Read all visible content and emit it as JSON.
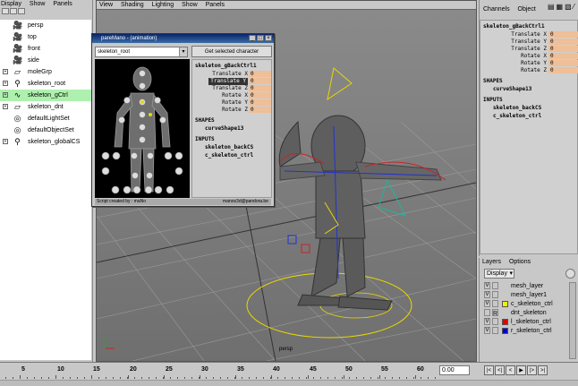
{
  "outliner": {
    "menu": [
      "Display",
      "Show",
      "Panels"
    ],
    "items": [
      {
        "label": "persp",
        "icon": "camera-icon",
        "expand": ""
      },
      {
        "label": "top",
        "icon": "camera-icon",
        "expand": ""
      },
      {
        "label": "front",
        "icon": "camera-icon",
        "expand": ""
      },
      {
        "label": "side",
        "icon": "camera-icon",
        "expand": ""
      },
      {
        "label": "moleGrp",
        "icon": "group-icon",
        "expand": "+"
      },
      {
        "label": "skeleton_root",
        "icon": "joint-icon",
        "expand": "+"
      },
      {
        "label": "skeleton_gCtrl",
        "icon": "curve-icon",
        "expand": "+"
      },
      {
        "label": "skeleton_dnt",
        "icon": "group-icon",
        "expand": "+"
      },
      {
        "label": "defaultLightSet",
        "icon": "set-icon",
        "expand": ""
      },
      {
        "label": "defaultObjectSet",
        "icon": "set-icon",
        "expand": ""
      },
      {
        "label": "skeleton_globalCS",
        "icon": "joint-icon",
        "expand": "+"
      }
    ],
    "selected_index": 6
  },
  "viewport": {
    "menu": [
      "View",
      "Shading",
      "Lighting",
      "Show",
      "Panels"
    ],
    "camera_label": "persp"
  },
  "channel_box": {
    "menu": [
      "Channels",
      "Object"
    ],
    "object": "skeleton_gBackCtrl1",
    "channels": [
      {
        "label": "Translate X",
        "value": "0"
      },
      {
        "label": "Translate Y",
        "value": "0"
      },
      {
        "label": "Translate Z",
        "value": "0"
      },
      {
        "label": "Rotate X",
        "value": "0"
      },
      {
        "label": "Rotate Y",
        "value": "0"
      },
      {
        "label": "Rotate Z",
        "value": "0"
      }
    ],
    "shapes_header": "SHAPES",
    "shape": "curveShape13",
    "inputs_header": "INPUTS",
    "inputs": [
      "skeleton_backCS",
      "c_skeleton_ctrl"
    ]
  },
  "layers": {
    "menu": [
      "Layers",
      "Options"
    ],
    "display_mode": "Display",
    "items": [
      {
        "v": "V",
        "name": "mesh_layer",
        "color": "",
        "flag": ""
      },
      {
        "v": "V",
        "name": "mesh_layer1",
        "color": "",
        "flag": ""
      },
      {
        "v": "V",
        "name": "c_skeleton_ctrl",
        "color": "#f0f000",
        "flag": ""
      },
      {
        "v": "",
        "name": "dnt_skeleton",
        "color": "",
        "flag": "R"
      },
      {
        "v": "V",
        "name": "l_skeleton_ctrl",
        "color": "#e00000",
        "flag": ""
      },
      {
        "v": "V",
        "name": "r_skeleton_ctrl",
        "color": "#0000d0",
        "flag": ""
      }
    ]
  },
  "timeline": {
    "ticks": [
      "5",
      "10",
      "15",
      "20",
      "25",
      "30",
      "35",
      "40",
      "45",
      "50",
      "55",
      "60"
    ],
    "current_frame": "0.00",
    "playback_buttons": [
      "|<",
      "<|",
      "<",
      "▶",
      "|>",
      ">|"
    ]
  },
  "picker": {
    "title": "pareMano  - (animation)",
    "character": "skeleton_root",
    "get_button": "Get selected character",
    "object": "skeleton_gBackCtrl1",
    "channels": [
      {
        "label": "Translate X",
        "value": "0"
      },
      {
        "label": "Translate Y",
        "value": "0"
      },
      {
        "label": "Translate Z",
        "value": "0"
      },
      {
        "label": "Rotate X",
        "value": "0"
      },
      {
        "label": "Rotate Y",
        "value": "0"
      },
      {
        "label": "Rotate Z",
        "value": "0"
      }
    ],
    "highlighted_channel": 1,
    "shapes_header": "SHAPES",
    "shape": "curveShape13",
    "inputs_header": "INPUTS",
    "inputs": [
      "skeleton_backCS",
      "c_skeleton_ctrl"
    ],
    "footer_left": "Script created by : maNo",
    "footer_right": "manos3d@pandora.be"
  },
  "colors": {
    "selection": "#aef0ae",
    "channel_value": "#eebf98",
    "grid": "#999999"
  }
}
